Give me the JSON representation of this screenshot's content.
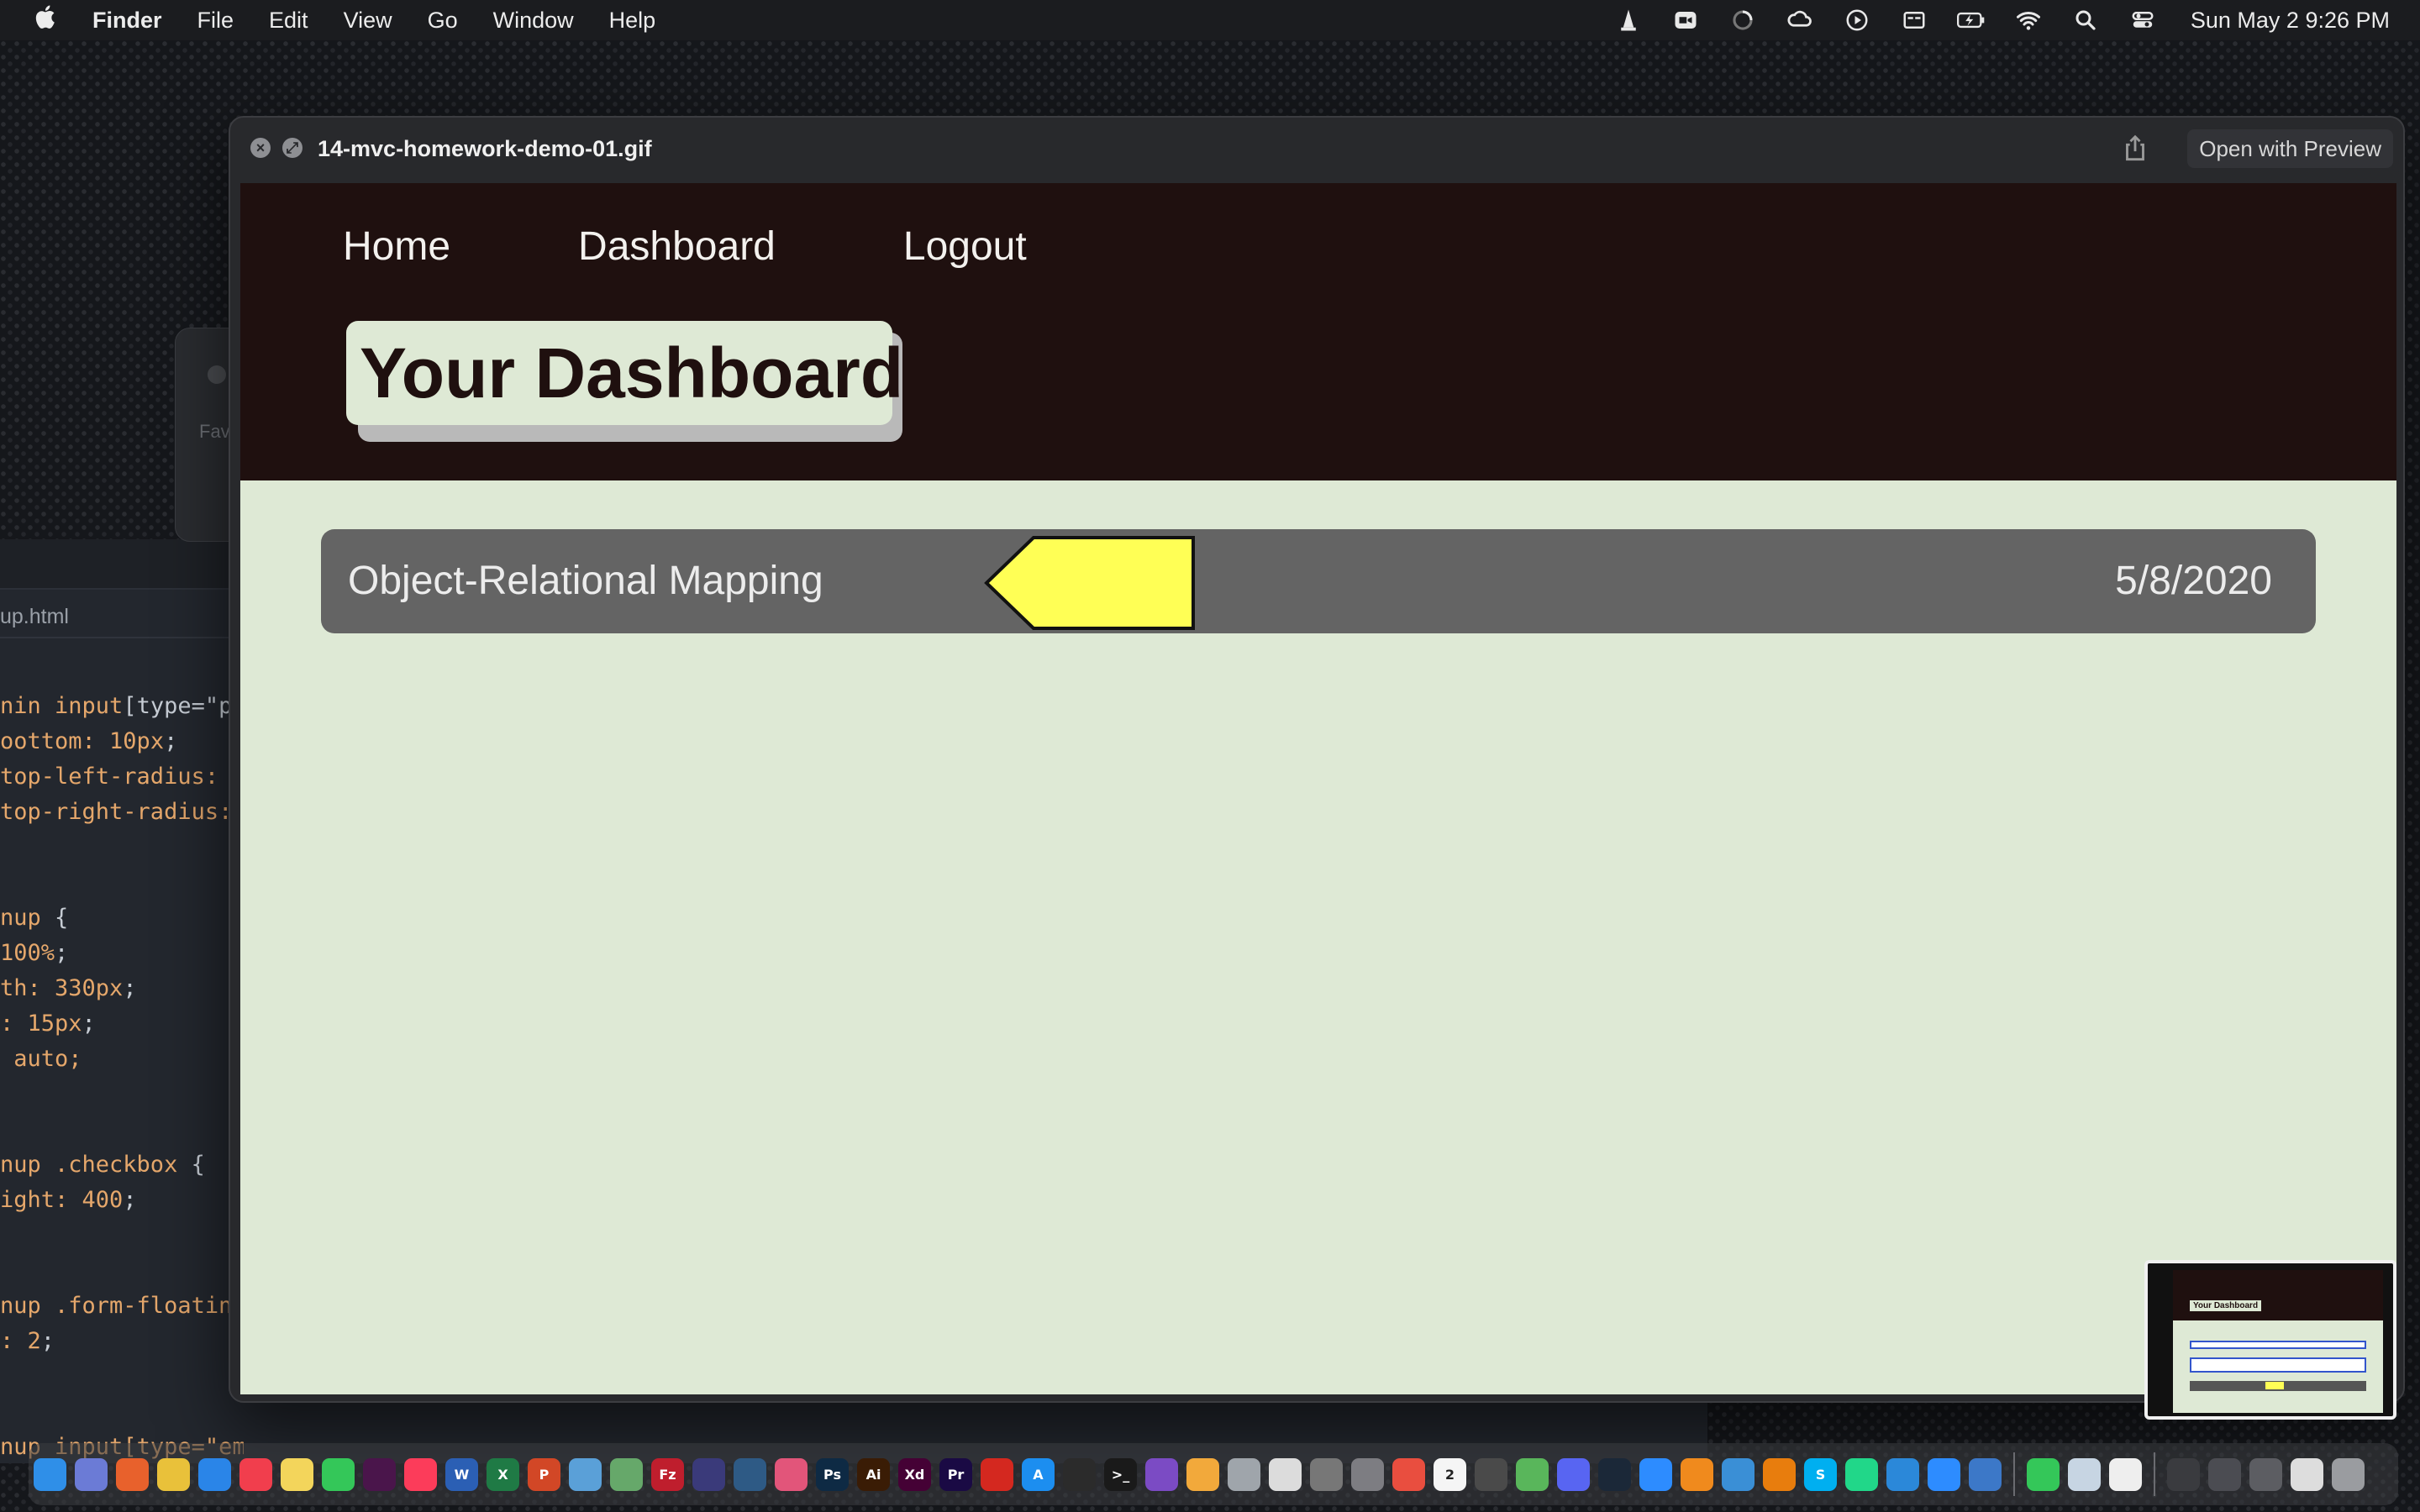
{
  "menubar": {
    "app_name": "Finder",
    "items": [
      "File",
      "Edit",
      "View",
      "Go",
      "Window",
      "Help"
    ],
    "clock": "Sun May 2  9:26 PM",
    "status_icons": [
      "vlc-icon",
      "zoom-icon",
      "loading-icon",
      "creative-cloud-icon",
      "play-icon",
      "display-icon",
      "battery-icon",
      "wifi-icon",
      "search-icon",
      "control-center-icon"
    ]
  },
  "editor": {
    "tab_label": "up.html",
    "code_lines": [
      {
        "a": "nin ",
        "b": "input",
        "c": "[type=\"p"
      },
      {
        "a": "oottom: ",
        "b": "10px",
        "c": ";"
      },
      {
        "a": "top-left-radius: ",
        "b": "",
        "c": ""
      },
      {
        "a": "top-right-radius:",
        "b": "",
        "c": ""
      },
      {
        "a": "",
        "b": "",
        "c": ""
      },
      {
        "a": "",
        "b": "",
        "c": ""
      },
      {
        "a": "nup ",
        "b": "",
        "c": "{"
      },
      {
        "a": "100%",
        "b": "",
        "c": ";"
      },
      {
        "a": "th: ",
        "b": "330px",
        "c": ";"
      },
      {
        "a": ": ",
        "b": "15px",
        "c": ";"
      },
      {
        "a": " auto;",
        "b": "",
        "c": ""
      },
      {
        "a": "",
        "b": "",
        "c": ""
      },
      {
        "a": "",
        "b": "",
        "c": ""
      },
      {
        "a": "nup .checkbox ",
        "b": "",
        "c": "{"
      },
      {
        "a": "ight: ",
        "b": "400",
        "c": ";"
      },
      {
        "a": "",
        "b": "",
        "c": ""
      },
      {
        "a": "",
        "b": "",
        "c": ""
      },
      {
        "a": "nup .form-floatin",
        "b": "",
        "c": ""
      },
      {
        "a": ": ",
        "b": "2",
        "c": ";"
      },
      {
        "a": "",
        "b": "",
        "c": ""
      },
      {
        "a": "",
        "b": "",
        "c": ""
      },
      {
        "a": "nup input",
        "b": "[type=\"email\"]",
        "c": " {"
      }
    ]
  },
  "background_finder": {
    "sidebar_label": "Fav"
  },
  "quicklook": {
    "filename": "14-mvc-homework-demo-01.gif",
    "open_button": "Open with Preview"
  },
  "app": {
    "nav": [
      "Home",
      "Dashboard",
      "Logout"
    ],
    "page_title": "Your Dashboard",
    "posts": [
      {
        "title": "Object-Relational Mapping",
        "date": "5/8/2020"
      }
    ],
    "colors": {
      "header_bg": "#1f100f",
      "body_bg": "#dee9d5",
      "card_bg": "#646464",
      "arrow_fill": "#ffff55"
    }
  },
  "thumbnail": {
    "title": "Your Dashboard"
  },
  "dock": {
    "items": [
      {
        "name": "finder-icon",
        "label": "",
        "color": "#2f8fe8"
      },
      {
        "name": "launchpad-icon",
        "label": "",
        "color": "#6b7bd6"
      },
      {
        "name": "firefox-icon",
        "label": "",
        "color": "#e8612c"
      },
      {
        "name": "chrome-icon",
        "label": "",
        "color": "#e9c13a"
      },
      {
        "name": "safari-icon",
        "label": "",
        "color": "#2a85e8"
      },
      {
        "name": "news-icon",
        "label": "",
        "color": "#f13e4d"
      },
      {
        "name": "notes-icon",
        "label": "",
        "color": "#f3d55b"
      },
      {
        "name": "messages-icon",
        "label": "",
        "color": "#34c759"
      },
      {
        "name": "slack-icon",
        "label": "",
        "color": "#4a154b"
      },
      {
        "name": "music-icon",
        "label": "",
        "color": "#fc3c5a"
      },
      {
        "name": "word-icon",
        "label": "W",
        "color": "#2b5fb4"
      },
      {
        "name": "excel-icon",
        "label": "X",
        "color": "#1f7a45"
      },
      {
        "name": "powerpoint-icon",
        "label": "P",
        "color": "#d24726"
      },
      {
        "name": "network-icon",
        "label": "",
        "color": "#5aa0d8"
      },
      {
        "name": "atom-icon",
        "label": "",
        "color": "#66a86a"
      },
      {
        "name": "filezilla-icon",
        "label": "Fz",
        "color": "#bf1e2d"
      },
      {
        "name": "eclipse-icon",
        "label": "",
        "color": "#3a3a7a"
      },
      {
        "name": "mysql-workbench-icon",
        "label": "",
        "color": "#2e5a85"
      },
      {
        "name": "cc-icon",
        "label": "",
        "color": "#e2557a"
      },
      {
        "name": "photoshop-icon",
        "label": "Ps",
        "color": "#0e2a44"
      },
      {
        "name": "illustrator-icon",
        "label": "Ai",
        "color": "#3a1c05"
      },
      {
        "name": "xd-icon",
        "label": "Xd",
        "color": "#450135"
      },
      {
        "name": "premiere-icon",
        "label": "Pr",
        "color": "#1a0a44"
      },
      {
        "name": "acrobat-icon",
        "label": "",
        "color": "#d4281f"
      },
      {
        "name": "app-store-icon",
        "label": "A",
        "color": "#1c8ef0"
      },
      {
        "name": "activity-monitor-icon",
        "label": "",
        "color": "#2b2b2b"
      },
      {
        "name": "terminal-icon",
        "label": ">_",
        "color": "#1a1a1a"
      },
      {
        "name": "visual-studio-icon",
        "label": "",
        "color": "#7b4bc4"
      },
      {
        "name": "photos-icon",
        "label": "",
        "color": "#f2a93b"
      },
      {
        "name": "game-icon",
        "label": "",
        "color": "#9fa5ab"
      },
      {
        "name": "unity-icon",
        "label": "",
        "color": "#dcdcdc"
      },
      {
        "name": "chess-icon",
        "label": "",
        "color": "#777777"
      },
      {
        "name": "system-prefs-icon",
        "label": "",
        "color": "#7d7d82"
      },
      {
        "name": "reminders-icon",
        "label": "",
        "color": "#e94e3f"
      },
      {
        "name": "calendar-icon",
        "label": "2",
        "color": "#f5f5f5"
      },
      {
        "name": "calculator-icon",
        "label": "",
        "color": "#4a4a4a"
      },
      {
        "name": "maps-icon",
        "label": "",
        "color": "#59b65b"
      },
      {
        "name": "discord-icon",
        "label": "",
        "color": "#5865f2"
      },
      {
        "name": "steam-icon",
        "label": "",
        "color": "#1b2838"
      },
      {
        "name": "zoom-dock-icon",
        "label": "",
        "color": "#2d8cff"
      },
      {
        "name": "vlc-dock-icon",
        "label": "",
        "color": "#f08a1d"
      },
      {
        "name": "quicktime-icon",
        "label": "",
        "color": "#3a8fd6"
      },
      {
        "name": "blender-icon",
        "label": "",
        "color": "#e87d0d"
      },
      {
        "name": "skype-icon",
        "label": "S",
        "color": "#00aff0"
      },
      {
        "name": "pycharm-icon",
        "label": "",
        "color": "#21d789"
      },
      {
        "name": "wunderlist-icon",
        "label": "",
        "color": "#2b88d9"
      },
      {
        "name": "zoom-app-icon",
        "label": "",
        "color": "#2d8cff"
      },
      {
        "name": "network-util-icon",
        "label": "",
        "color": "#3c78c8"
      },
      {
        "name": "facetime-icon",
        "label": "",
        "color": "#34c759"
      },
      {
        "name": "preview-icon",
        "label": "",
        "color": "#c7d5e3"
      },
      {
        "name": "textedit-icon",
        "label": "",
        "color": "#eeeeee"
      },
      {
        "name": "folder-stack-icon",
        "label": "",
        "color": "#3a3b3f"
      },
      {
        "name": "screenshot-stack-icon",
        "label": "",
        "color": "#4b4c52"
      },
      {
        "name": "downloads-stack-icon",
        "label": "",
        "color": "#5c5d62"
      },
      {
        "name": "recent-stack-icon",
        "label": "",
        "color": "#dddddd"
      },
      {
        "name": "trash-icon",
        "label": "",
        "color": "#9a9ca0"
      }
    ]
  }
}
